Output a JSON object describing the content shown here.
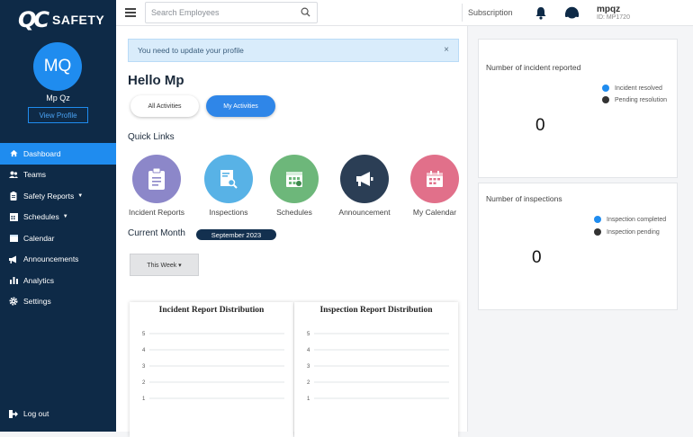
{
  "brand": {
    "mark": "QC",
    "name": "SAFETY"
  },
  "profile": {
    "initials": "MQ",
    "name": "Mp Qz",
    "view_label": "View Profile"
  },
  "sidebar": {
    "items": [
      {
        "label": "Dashboard",
        "icon": "home-icon",
        "active": true
      },
      {
        "label": "Teams",
        "icon": "users-icon"
      },
      {
        "label": "Safety Reports",
        "icon": "clipboard-icon",
        "caret": true
      },
      {
        "label": "Schedules",
        "icon": "calendar-grid-icon",
        "caret": true
      },
      {
        "label": "Calendar",
        "icon": "calendar-icon"
      },
      {
        "label": "Announcements",
        "icon": "megaphone-icon"
      },
      {
        "label": "Analytics",
        "icon": "bar-chart-icon"
      },
      {
        "label": "Settings",
        "icon": "gear-icon"
      }
    ],
    "logout_label": "Log out"
  },
  "topbar": {
    "search_placeholder": "Search Employees",
    "subscription_label": "Subscription",
    "user_name": "mpqz",
    "user_id": "ID: MP1720"
  },
  "main": {
    "alert_text": "You need to update your profile",
    "alert_close": "×",
    "greeting": "Hello Mp",
    "pill_all": "All Activities",
    "pill_my": "My Activities",
    "quick_links_title": "Quick Links",
    "quick_links": [
      {
        "label": "Incident Reports",
        "color": "#8c87c9",
        "icon": "clipboard-icon"
      },
      {
        "label": "Inspections",
        "color": "#58b2e6",
        "icon": "search-document-icon"
      },
      {
        "label": "Schedules",
        "color": "#6db77a",
        "icon": "calendar-grid-icon"
      },
      {
        "label": "Announcement",
        "color": "#2b3e55",
        "icon": "megaphone-icon"
      },
      {
        "label": "My Calendar",
        "color": "#e1708a",
        "icon": "calendar-icon"
      }
    ],
    "current_month_label": "Current Month",
    "month_badge": "September 2023",
    "week_button": "This Week ▾"
  },
  "chart_data": [
    {
      "type": "bar",
      "title": "Incident Report Distribution",
      "categories": [],
      "values": [],
      "y_ticks": [
        "5",
        "4",
        "3",
        "2",
        "1"
      ],
      "ylim": [
        0,
        5
      ]
    },
    {
      "type": "bar",
      "title": "Inspection Report Distribution",
      "categories": [],
      "values": [],
      "y_ticks": [
        "5",
        "4",
        "3",
        "2",
        "1"
      ],
      "ylim": [
        0,
        5
      ]
    }
  ],
  "stats": {
    "incident": {
      "title": "Number of incident reported",
      "value": "0",
      "legend": [
        {
          "label": "Incident resolved",
          "color": "#1f8cef"
        },
        {
          "label": "Pending resolution",
          "color": "#333333"
        }
      ]
    },
    "inspection": {
      "title": "Number of inspections",
      "value": "0",
      "legend": [
        {
          "label": "Inspection completed",
          "color": "#1f8cef"
        },
        {
          "label": "Inspection pending",
          "color": "#333333"
        }
      ]
    }
  }
}
